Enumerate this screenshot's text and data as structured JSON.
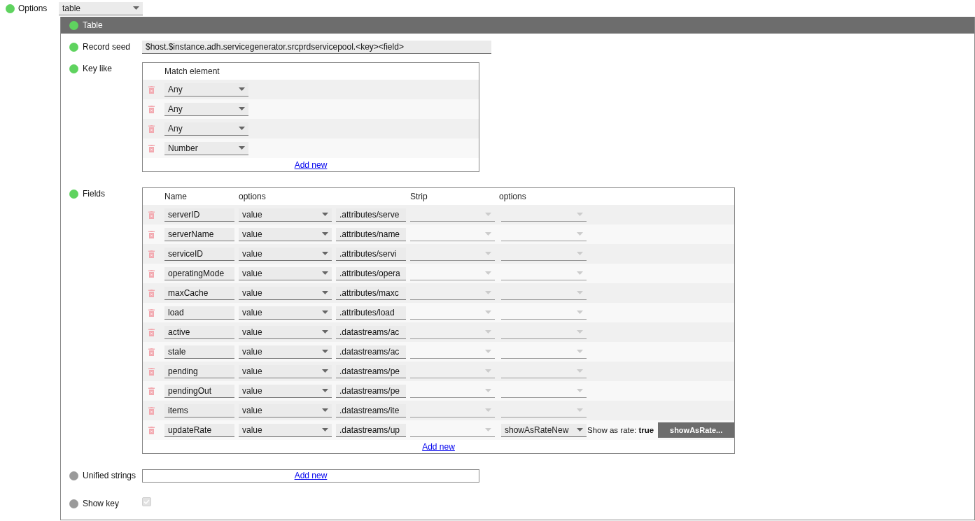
{
  "options": {
    "label": "Options",
    "active": true,
    "value": "table"
  },
  "panel": {
    "title": "Table",
    "active": true,
    "record_seed": {
      "label": "Record seed",
      "active": true,
      "value": "$host.$instance.adh.servicegenerator.srcprdservicepool.<key><field>"
    },
    "key_like": {
      "label": "Key like",
      "active": true,
      "column": "Match element",
      "add_new": "Add new",
      "rows": [
        {
          "value": "Any"
        },
        {
          "value": "Any"
        },
        {
          "value": "Any"
        },
        {
          "value": "Number"
        }
      ]
    },
    "fields": {
      "label": "Fields",
      "active": true,
      "columns": [
        "Name",
        "options",
        "Strip",
        "options"
      ],
      "add_new": "Add new",
      "rows": [
        {
          "name": "serverID",
          "option": "value",
          "path": ".attributes/serve",
          "strip_disabled": true,
          "option2": {
            "disabled": true
          }
        },
        {
          "name": "serverName",
          "option": "value",
          "path": ".attributes/name",
          "strip_disabled": true,
          "option2": {
            "disabled": true
          }
        },
        {
          "name": "serviceID",
          "option": "value",
          "path": ".attributes/servi",
          "strip_disabled": true,
          "option2": {
            "disabled": true
          }
        },
        {
          "name": "operatingMode",
          "option": "value",
          "path": ".attributes/opera",
          "strip_disabled": true,
          "option2": {
            "disabled": true
          }
        },
        {
          "name": "maxCache",
          "option": "value",
          "path": ".attributes/maxc",
          "strip_disabled": true,
          "option2": {
            "disabled": true
          }
        },
        {
          "name": "load",
          "option": "value",
          "path": ".attributes/load",
          "strip_disabled": true,
          "option2": {
            "disabled": true
          }
        },
        {
          "name": "active",
          "option": "value",
          "path": ".datastreams/ac",
          "strip_disabled": true,
          "option2": {
            "disabled": true
          }
        },
        {
          "name": "stale",
          "option": "value",
          "path": ".datastreams/ac",
          "strip_disabled": true,
          "option2": {
            "disabled": true
          }
        },
        {
          "name": "pending",
          "option": "value",
          "path": ".datastreams/pe",
          "strip_disabled": true,
          "option2": {
            "disabled": true
          }
        },
        {
          "name": "pendingOut",
          "option": "value",
          "path": ".datastreams/pe",
          "strip_disabled": true,
          "option2": {
            "disabled": true
          }
        },
        {
          "name": "items",
          "option": "value",
          "path": ".datastreams/ite",
          "strip_disabled": true,
          "option2": {
            "disabled": true
          }
        },
        {
          "name": "updateRate",
          "option": "value",
          "path": ".datastreams/up",
          "strip_disabled": true,
          "option2": {
            "value": "showAsRateNew",
            "disabled": false
          },
          "note": "Show as rate: **true**",
          "button": "showAsRate..."
        }
      ]
    },
    "unified_strings": {
      "label": "Unified strings",
      "active": false,
      "add_new": "Add new"
    },
    "show_key": {
      "label": "Show key",
      "active": false,
      "checked": true,
      "disabled": true
    }
  }
}
